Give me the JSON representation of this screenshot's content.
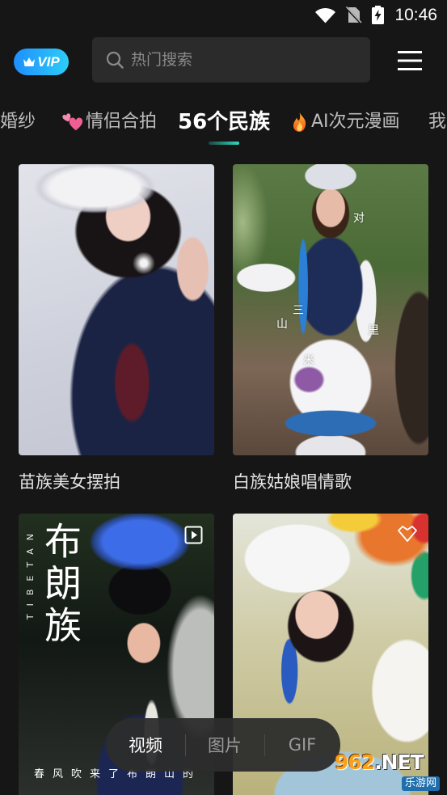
{
  "status_bar": {
    "time": "10:46",
    "icons": [
      "wifi-icon",
      "no-sim-icon",
      "battery-charging-icon"
    ]
  },
  "header": {
    "vip": {
      "label": "VIP",
      "icon": "crown-icon"
    },
    "search": {
      "placeholder": "热门搜索",
      "icon": "search-icon"
    },
    "menu_icon": "menu-icon"
  },
  "tabs": [
    {
      "label": "婚纱",
      "selected": false
    },
    {
      "label": "情侣合拍",
      "icon": "two-hearts-icon",
      "selected": false
    },
    {
      "label": "56个民族",
      "selected": true
    },
    {
      "label": "AI次元漫画",
      "icon": "fire-icon",
      "selected": false
    },
    {
      "label": "我",
      "selected": false
    }
  ],
  "cards": [
    {
      "title": "苗族美女摆拍"
    },
    {
      "title": "白族姑娘唱情歌",
      "overlay_text": [
        "对",
        "三",
        "山",
        "里",
        "米"
      ]
    },
    {
      "badge_icon": "play-icon",
      "overlay": {
        "title": "布朗族",
        "subtitle": "TIBETAN",
        "caption": "春风吹来了布朗山的"
      }
    },
    {
      "badge_icon": "diamond-icon"
    }
  ],
  "media_filter": {
    "options": [
      {
        "label": "视频",
        "selected": true
      },
      {
        "label": "图片",
        "selected": false
      },
      {
        "label": "GIF",
        "selected": false
      }
    ]
  },
  "watermark": {
    "number": "962",
    "suffix": ".NET",
    "name": "乐游网"
  },
  "colors": {
    "background": "#161616",
    "accent": "#2fd9c0",
    "vip_start": "#1e8fff",
    "vip_end": "#2ccdf7",
    "search_bg": "#2b2b2b",
    "tab_inactive": "#bcbcbc",
    "filter_inactive": "#9a9a9a"
  }
}
